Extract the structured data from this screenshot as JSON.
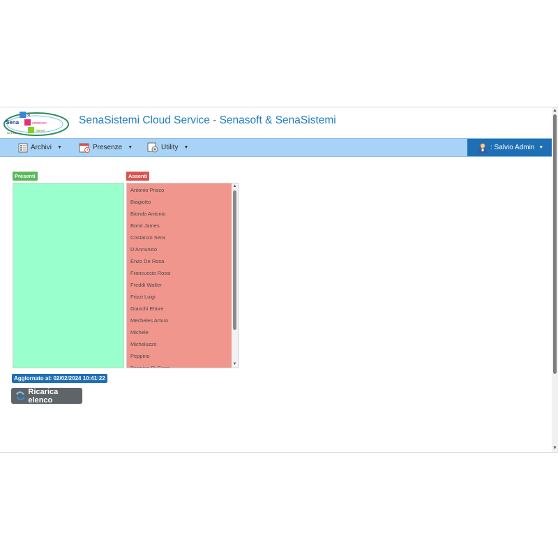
{
  "app": {
    "title": "SenaSistemi Cloud Service - Senasoft & SenaSistemi",
    "logo_text": "Sena Soft Commerce Sistemi"
  },
  "navbar": {
    "items": [
      {
        "label": "Archivi",
        "icon": "archive-icon"
      },
      {
        "label": "Presenze",
        "icon": "calendar-icon"
      },
      {
        "label": "Utility",
        "icon": "utility-icon"
      }
    ],
    "user": {
      "label": ": Salvio Admin",
      "icon": "user-avatar-icon"
    }
  },
  "presenti": {
    "label": "Presenti",
    "items": []
  },
  "assenti": {
    "label": "Assenti",
    "items": [
      "Antonio Prisco",
      "Biagiotto",
      "Biondo Antonio",
      "Bond James",
      "Costanzo Sera",
      "D'Annunzio",
      "Enzo De Rosa",
      "Francuccio Rossi",
      "Freddi Walter",
      "Frizzi Luigi",
      "Gianchi Ettore",
      "Mecheles Arturo",
      "Michele",
      "Micheluzzo",
      "Peppino",
      "Peppino Di Capri"
    ]
  },
  "status": {
    "updated_label": "Aggiornato al: 02/02/2024 10:41:22"
  },
  "actions": {
    "reload_label": "Ricarica elenco"
  },
  "colors": {
    "navbar_bg": "#a8d3f6",
    "title_blue": "#1f7bc1",
    "presenti_bg": "#99ffcc",
    "assenti_bg": "#f1968d",
    "badge_green": "#5cb85c",
    "badge_red": "#d9534f",
    "user_menu_bg": "#1f6fb5"
  }
}
